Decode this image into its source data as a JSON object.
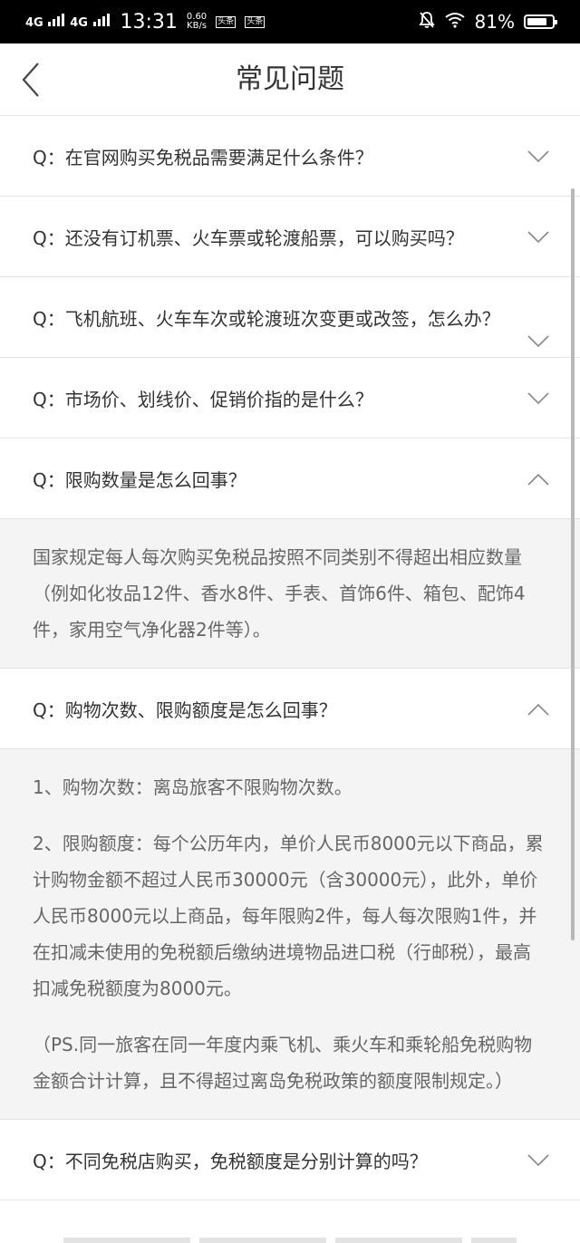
{
  "status_bar": {
    "signal_1": "4G",
    "signal_2": "4G",
    "time": "13:31",
    "speed_value": "0.60",
    "speed_unit": "KB/s",
    "badge_1": "头条",
    "badge_2": "头条",
    "battery": "81%",
    "battery_level": 0.81
  },
  "header": {
    "title": "常见问题"
  },
  "faq": [
    {
      "question": "Q：在官网购买免税品需要满足什么条件？",
      "expanded": false
    },
    {
      "question": "Q：还没有订机票、火车票或轮渡船票，可以购买吗？",
      "expanded": false
    },
    {
      "question": "Q：飞机航班、火车车次或轮渡班次变更或改签，怎么办？",
      "expanded": false
    },
    {
      "question": "Q：市场价、划线价、促销价指的是什么？",
      "expanded": false
    },
    {
      "question": "Q：限购数量是怎么回事？",
      "expanded": true,
      "answer": [
        "国家规定每人每次购买免税品按照不同类别不得超出相应数量（例如化妆品12件、香水8件、手表、首饰6件、箱包、配饰4件，家用空气净化器2件等）。"
      ]
    },
    {
      "question": "Q：购物次数、限购额度是怎么回事？",
      "expanded": true,
      "answer": [
        "1、购物次数：离岛旅客不限购物次数。",
        "2、限购额度：每个公历年内，单价人民币8000元以下商品，累计购物金额不超过人民币30000元（含30000元），此外，单价人民币8000元以上商品，每年限购2件，每人每次限购1件，并在扣减未使用的免税额后缴纳进境物品进口税（行邮税），最高扣减免税额度为8000元。",
        "（PS.同一旅客在同一年度内乘飞机、乘火车和乘轮船免税购物金额合计计算，且不得超过离岛免税政策的额度限制规定。）"
      ]
    },
    {
      "question": "Q：不同免税店购买，免税额度是分别计算的吗？",
      "expanded": false
    }
  ]
}
